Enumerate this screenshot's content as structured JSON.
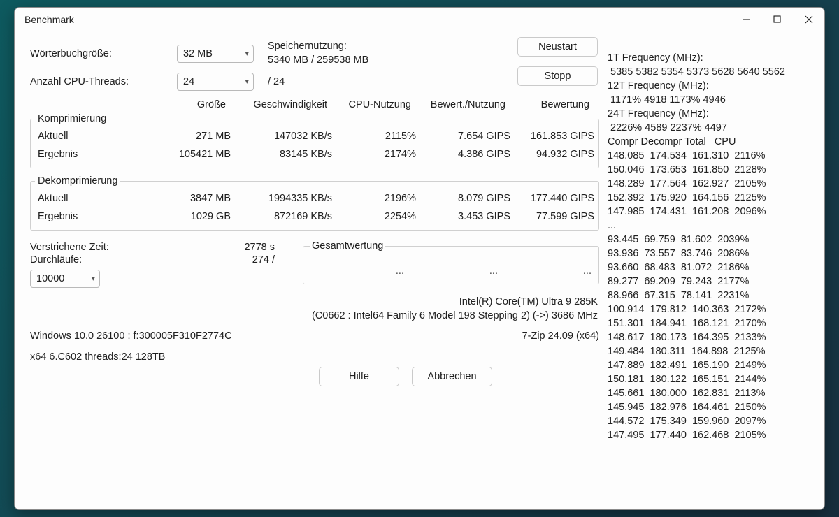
{
  "window": {
    "title": "Benchmark"
  },
  "controls": {
    "dict_size_label": "Wörterbuchgröße:",
    "dict_size_value": "32 MB",
    "threads_label": "Anzahl CPU-Threads:",
    "threads_value": "24",
    "threads_max": "/ 24",
    "mem_label": "Speichernutzung:",
    "mem_value": "5340 MB / 259538 MB",
    "restart": "Neustart",
    "stop": "Stopp"
  },
  "headers": {
    "size": "Größe",
    "speed": "Geschwindigkeit",
    "cpu_usage": "CPU-Nutzung",
    "rating_usage": "Bewert./Nutzung",
    "rating": "Bewertung"
  },
  "compress": {
    "legend": "Komprimierung",
    "current_label": "Aktuell",
    "result_label": "Ergebnis",
    "current": {
      "size": "271 MB",
      "speed": "147032 KB/s",
      "cpu": "2115%",
      "ru": "7.654 GIPS",
      "rating": "161.853 GIPS"
    },
    "result": {
      "size": "105421 MB",
      "speed": "83145 KB/s",
      "cpu": "2174%",
      "ru": "4.386 GIPS",
      "rating": "94.932 GIPS"
    }
  },
  "decompress": {
    "legend": "Dekomprimierung",
    "current_label": "Aktuell",
    "result_label": "Ergebnis",
    "current": {
      "size": "3847 MB",
      "speed": "1994335 KB/s",
      "cpu": "2196%",
      "ru": "8.079 GIPS",
      "rating": "177.440 GIPS"
    },
    "result": {
      "size": "1029 GB",
      "speed": "872169 KB/s",
      "cpu": "2254%",
      "ru": "3.453 GIPS",
      "rating": "77.599 GIPS"
    }
  },
  "info": {
    "elapsed_label": "Verstrichene Zeit:",
    "elapsed_value": "2778 s",
    "passes_label": "Durchläufe:",
    "passes_value": "274 /",
    "passes_target": "10000"
  },
  "overall": {
    "legend": "Gesamtwertung",
    "c1": "...",
    "c2": "...",
    "c3": "..."
  },
  "sys": {
    "cpu": "Intel(R) Core(TM) Ultra 9 285K",
    "cpu2": "(C0662 : Intel64 Family 6 Model 198 Stepping 2) (->) 3686 MHz",
    "os": "Windows 10.0 26100 : f:300005F310F2774C",
    "app": "7-Zip 24.09 (x64)",
    "arch": "x64 6.C602 threads:24 128TB"
  },
  "buttons": {
    "help": "Hilfe",
    "cancel": "Abbrechen"
  },
  "freq": {
    "h1": "1T Frequency (MHz):",
    "l1": " 5385 5382 5354 5373 5628 5640 5562",
    "h12": "12T Frequency (MHz):",
    "l12": " 1171% 4918 1173% 4946",
    "h24": "24T Frequency (MHz):",
    "l24": " 2226% 4589 2237% 4497",
    "cols": "Compr Decompr Total   CPU"
  },
  "log": [
    "148.085  174.534  161.310  2116%",
    "150.046  173.653  161.850  2128%",
    "148.289  177.564  162.927  2105%",
    "152.392  175.920  164.156  2125%",
    "147.985  174.431  161.208  2096%",
    "...",
    "93.445  69.759  81.602  2039%",
    "93.936  73.557  83.746  2086%",
    "93.660  68.483  81.072  2186%",
    "89.277  69.209  79.243  2177%",
    "88.966  67.315  78.141  2231%",
    "100.914  179.812  140.363  2172%",
    "151.301  184.941  168.121  2170%",
    "148.617  180.173  164.395  2133%",
    "149.484  180.311  164.898  2125%",
    "147.889  182.491  165.190  2149%",
    "150.181  180.122  165.151  2144%",
    "145.661  180.000  162.831  2113%",
    "145.945  182.976  164.461  2150%",
    "144.572  175.349  159.960  2097%",
    "147.495  177.440  162.468  2105%"
  ]
}
